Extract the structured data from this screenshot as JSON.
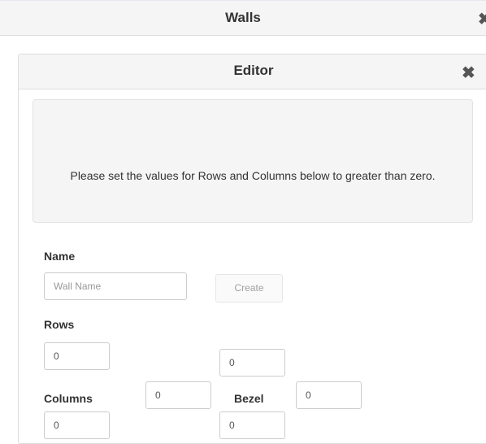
{
  "outer_dialog": {
    "title": "Walls",
    "close_glyph": "✖"
  },
  "editor": {
    "title": "Editor",
    "close_glyph": "✖",
    "alert_message": "Please set the values for Rows and Columns below to greater than zero.",
    "name": {
      "label": "Name",
      "placeholder": "Wall Name",
      "value": ""
    },
    "create_button": "Create",
    "rows": {
      "label": "Rows",
      "value": "0",
      "second_value": "0"
    },
    "columns": {
      "label": "Columns",
      "value": "0",
      "second_value": "0"
    },
    "bezel": {
      "label": "Bezel",
      "value": "0",
      "second_value": "0"
    }
  }
}
